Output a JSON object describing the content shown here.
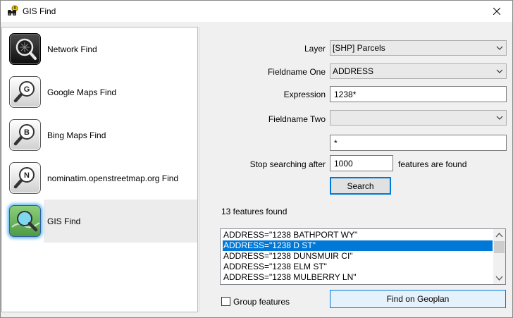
{
  "window": {
    "title": "GIS Find"
  },
  "sidebar": {
    "items": [
      {
        "label": "Network Find",
        "icon": "network-find-icon",
        "selected": false
      },
      {
        "label": "Google Maps Find",
        "icon": "google-maps-icon",
        "letter": "G",
        "selected": false
      },
      {
        "label": "Bing Maps Find",
        "icon": "bing-maps-icon",
        "letter": "B",
        "selected": false
      },
      {
        "label": "nominatim.openstreetmap.org Find",
        "icon": "nominatim-icon",
        "letter": "N",
        "selected": false
      },
      {
        "label": "GIS Find",
        "icon": "gis-find-icon",
        "selected": true
      }
    ]
  },
  "form": {
    "layer_label": "Layer",
    "layer_value": "[SHP] Parcels",
    "fieldname_one_label": "Fieldname One",
    "fieldname_one_value": "ADDRESS",
    "expression_label": "Expression",
    "expression_value": "1238*",
    "fieldname_two_label": "Fieldname Two",
    "fieldname_two_value": "",
    "expression_two_value": "*",
    "stop_label": "Stop searching after",
    "stop_value": "1000",
    "stop_suffix": "features are found",
    "search_button": "Search"
  },
  "results": {
    "count_text": "13 features found",
    "items": [
      "ADDRESS=\"1238 BATHPORT WY\"",
      "ADDRESS=\"1238 D ST\"",
      "ADDRESS=\"1238 DUNSMUIR CI\"",
      "ADDRESS=\"1238 ELM ST\"",
      "ADDRESS=\"1238 MULBERRY LN\""
    ],
    "selected_index": 1
  },
  "footer": {
    "group_label": "Group features",
    "group_checked": false,
    "find_button": "Find on Geoplan"
  },
  "colors": {
    "selection": "#0078d7",
    "focus": "#0078d7"
  }
}
